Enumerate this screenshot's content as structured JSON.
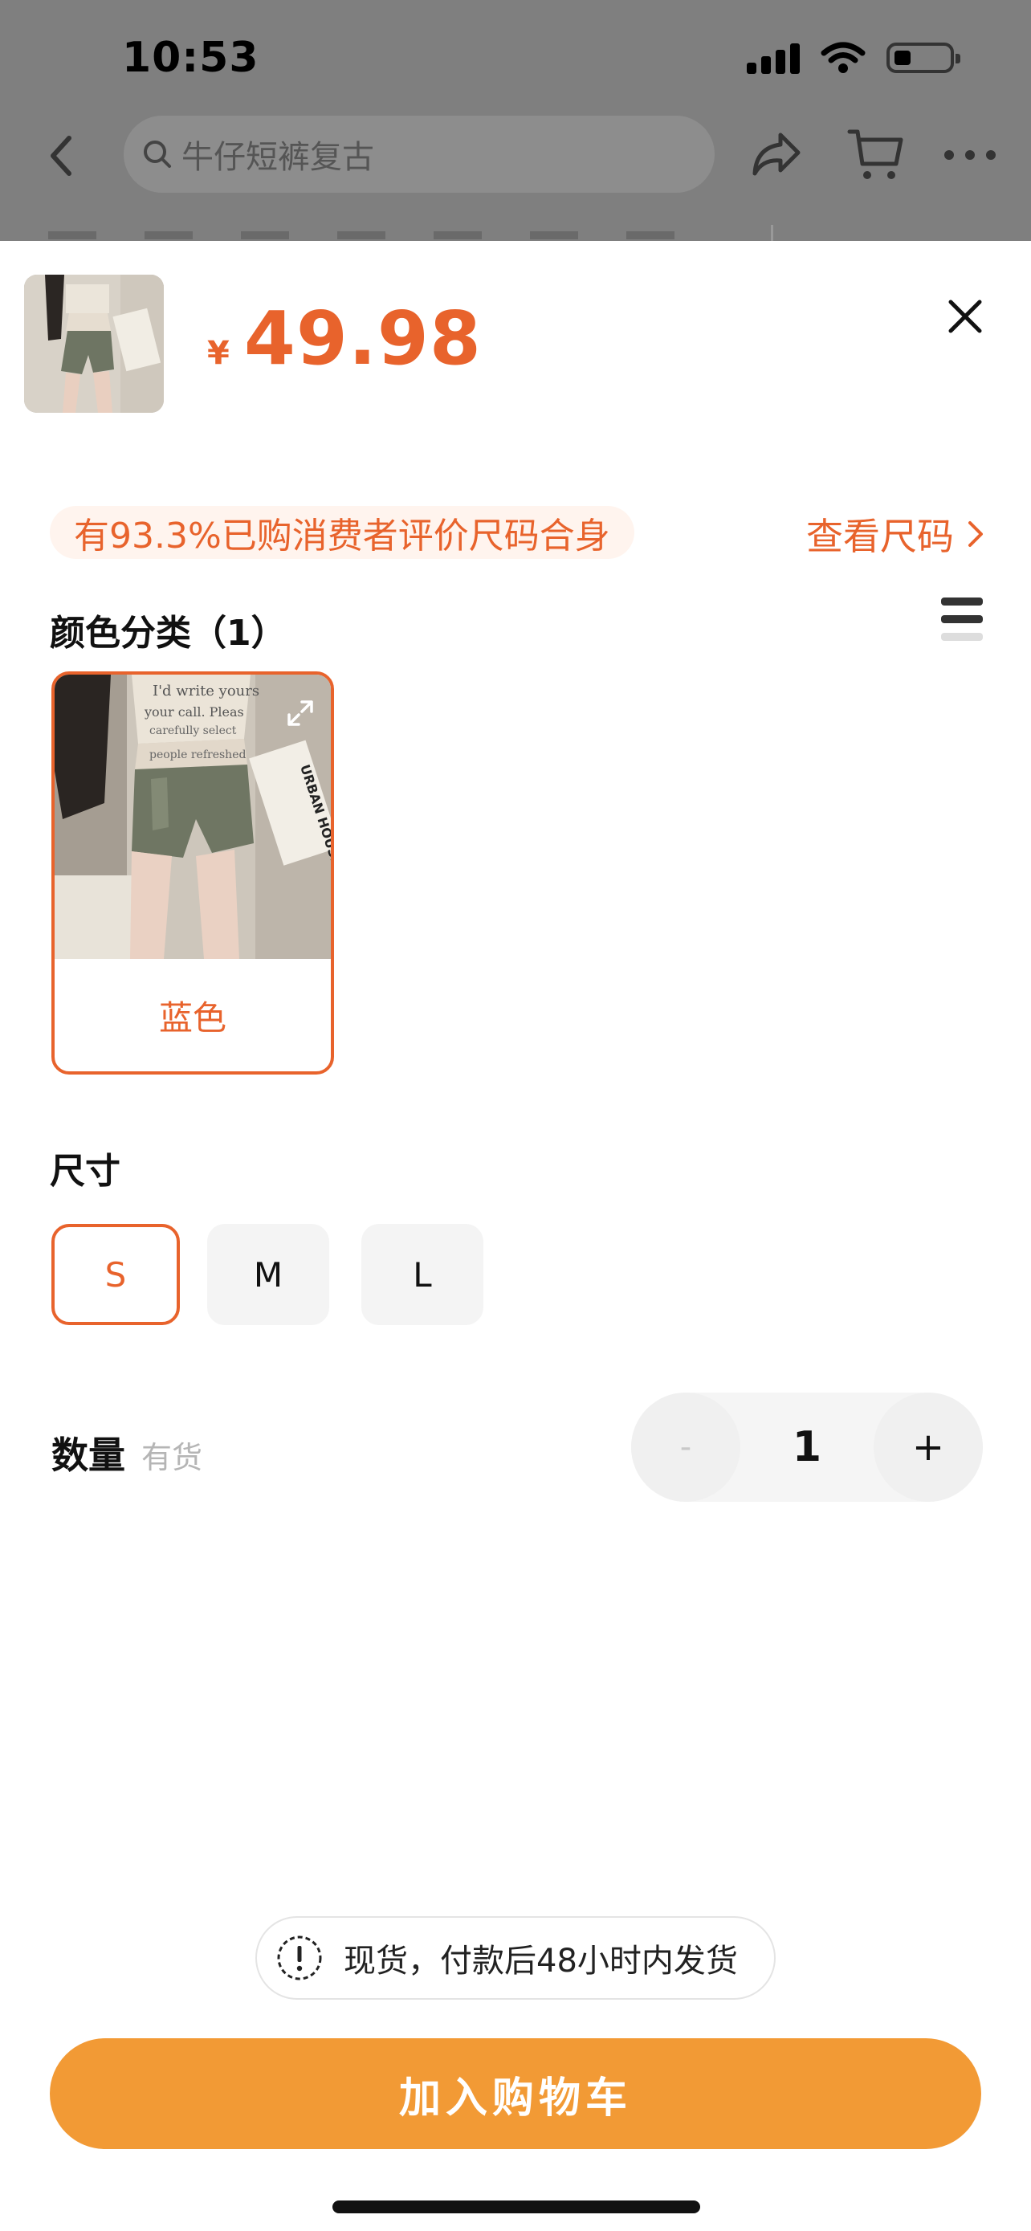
{
  "status_bar": {
    "time": "10:53"
  },
  "nav": {
    "search_placeholder": "牛仔短裤复古"
  },
  "product": {
    "currency": "¥",
    "price": "49.98"
  },
  "fit": {
    "text": "有93.3%已购消费者评价尺码合身",
    "size_chart_link": "查看尺码"
  },
  "color_section": {
    "title": "颜色分类（1）",
    "options": [
      {
        "label": "蓝色",
        "selected": true
      }
    ]
  },
  "size_section": {
    "title": "尺寸",
    "options": [
      {
        "label": "S",
        "selected": true
      },
      {
        "label": "M",
        "selected": false
      },
      {
        "label": "L",
        "selected": false
      }
    ]
  },
  "quantity": {
    "label": "数量",
    "stock": "有货",
    "minus": "-",
    "value": "1",
    "plus": "+"
  },
  "shipping_notice": "现货，付款后48小时内发货",
  "add_to_cart": "加入购物车",
  "colors": {
    "accent": "#E8632C",
    "button": "#F29A35"
  }
}
